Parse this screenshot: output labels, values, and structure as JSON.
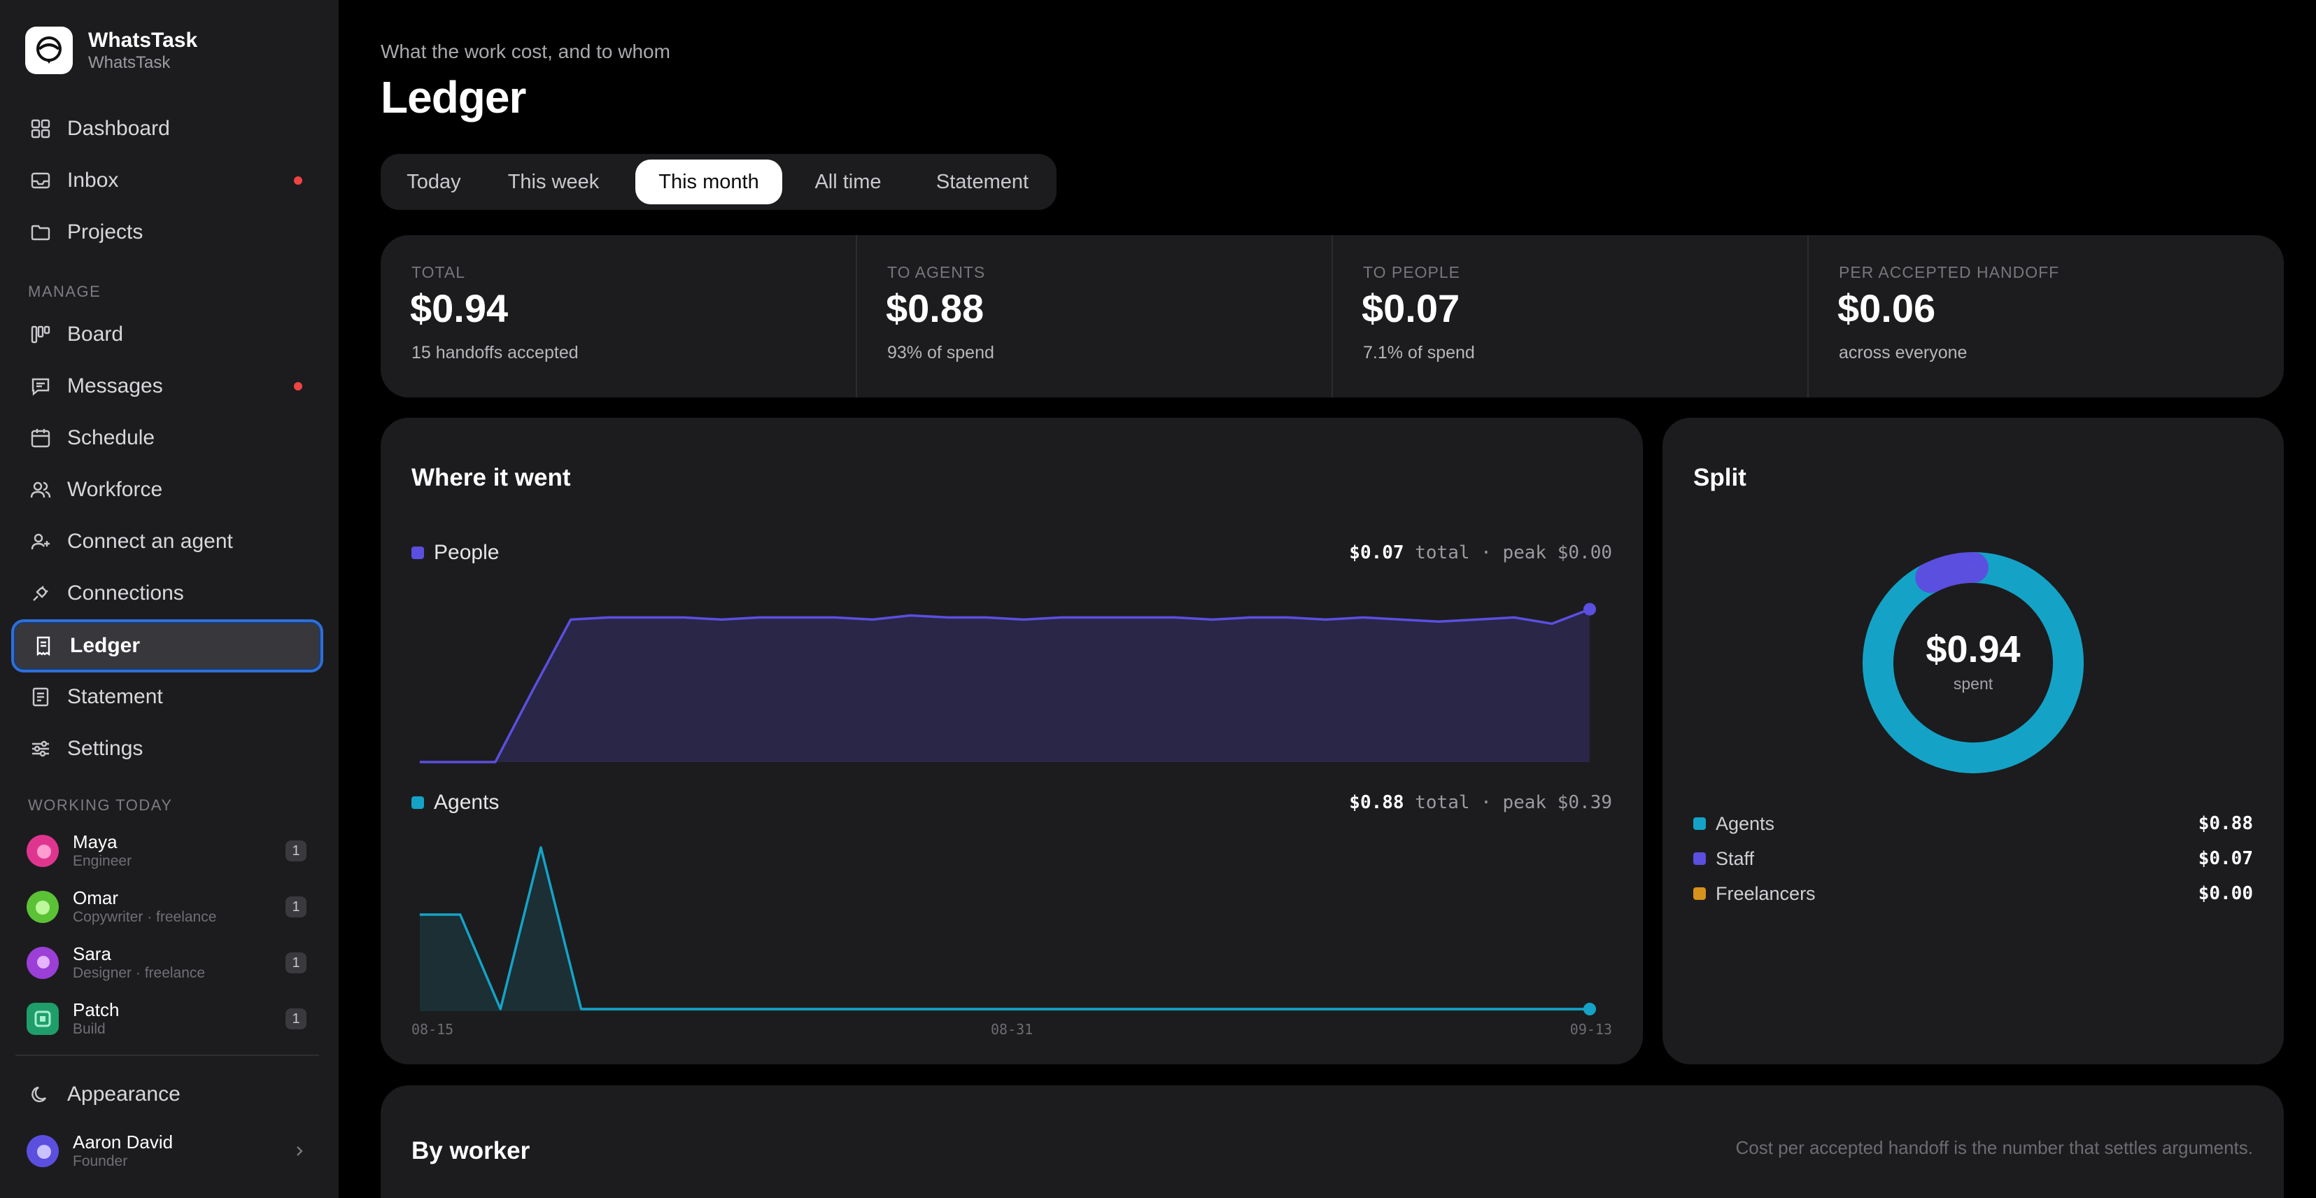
{
  "app": {
    "name": "WhatsTask",
    "workspace": "WhatsTask"
  },
  "nav": {
    "main": [
      {
        "label": "Dashboard",
        "icon": "grid-icon"
      },
      {
        "label": "Inbox",
        "icon": "inbox-icon",
        "unread": true
      },
      {
        "label": "Projects",
        "icon": "folder-icon"
      }
    ],
    "manage_label": "MANAGE",
    "manage": [
      {
        "label": "Board",
        "icon": "board-icon"
      },
      {
        "label": "Messages",
        "icon": "message-icon",
        "unread": true
      },
      {
        "label": "Schedule",
        "icon": "calendar-icon"
      },
      {
        "label": "Workforce",
        "icon": "users-icon"
      },
      {
        "label": "Connect an agent",
        "icon": "user-plus-icon"
      },
      {
        "label": "Connections",
        "icon": "plug-icon"
      },
      {
        "label": "Ledger",
        "icon": "receipt-icon",
        "active": true
      },
      {
        "label": "Statement",
        "icon": "document-icon"
      },
      {
        "label": "Settings",
        "icon": "sliders-icon"
      }
    ]
  },
  "working_today": {
    "label": "WORKING TODAY",
    "workers": [
      {
        "name": "Maya",
        "role": "Engineer",
        "count": "1",
        "color": "#e0358f"
      },
      {
        "name": "Omar",
        "role": "Copywriter · freelance",
        "count": "1",
        "color": "#5bc236"
      },
      {
        "name": "Sara",
        "role": "Designer · freelance",
        "count": "1",
        "color": "#9b3fd6"
      },
      {
        "name": "Patch",
        "role": "Build",
        "count": "1",
        "color": "#1f9e6b"
      }
    ]
  },
  "footer": {
    "appearance": "Appearance",
    "user": {
      "name": "Aaron David",
      "role": "Founder"
    }
  },
  "page": {
    "eyebrow": "What the work cost, and to whom",
    "title": "Ledger"
  },
  "tabs": [
    {
      "label": "Today"
    },
    {
      "label": "This week"
    },
    {
      "label": "This month",
      "active": true
    },
    {
      "label": "All time"
    },
    {
      "label": "Statement"
    }
  ],
  "stats": [
    {
      "label": "TOTAL",
      "value": "$0.94",
      "sub": "15 handoffs accepted"
    },
    {
      "label": "TO AGENTS",
      "value": "$0.88",
      "sub": "93% of spend"
    },
    {
      "label": "TO PEOPLE",
      "value": "$0.07",
      "sub": "7.1% of spend"
    },
    {
      "label": "PER ACCEPTED HANDOFF",
      "value": "$0.06",
      "sub": "across everyone"
    }
  ],
  "where": {
    "title": "Where it went",
    "people": {
      "name": "People",
      "total": "$0.07",
      "suffix": "total · peak $0.00"
    },
    "agents": {
      "name": "Agents",
      "total": "$0.88",
      "suffix": "total · peak $0.39"
    }
  },
  "split": {
    "title": "Split",
    "center_value": "$0.94",
    "center_label": "spent",
    "rows": [
      {
        "name": "Agents",
        "value": "$0.88",
        "color": "#14a3c7"
      },
      {
        "name": "Staff",
        "value": "$0.07",
        "color": "#5b4fe0"
      },
      {
        "name": "Freelancers",
        "value": "$0.00",
        "color": "#d6921c"
      }
    ]
  },
  "by_worker": {
    "title": "By worker",
    "note": "Cost per accepted handoff is the number that settles arguments."
  },
  "colors": {
    "people": "#5b4fe0",
    "agents": "#14a3c7",
    "accent": "#2e6fd8"
  },
  "chart_data": [
    {
      "type": "area",
      "series": [
        {
          "name": "People",
          "values": [
            0,
            0,
            0,
            0.0035,
            0.0069,
            0.007,
            0.007,
            0.007,
            0.0069,
            0.007,
            0.007,
            0.007,
            0.0069,
            0.0071,
            0.007,
            0.007,
            0.0069,
            0.007,
            0.007,
            0.007,
            0.007,
            0.0069,
            0.007,
            0.007,
            0.0069,
            0.007,
            0.0069,
            0.0068,
            0.0069,
            0.007,
            0.0067,
            0.0074
          ]
        }
      ],
      "x_ticks": [
        "08-15",
        "08-31",
        "09-13"
      ]
    },
    {
      "type": "area",
      "series": [
        {
          "name": "Agents",
          "values": [
            0.23,
            0.23,
            0.005,
            0.39,
            0.005,
            0.005,
            0.005,
            0.005,
            0.005,
            0.005,
            0.005,
            0.005,
            0.005,
            0.005,
            0.005,
            0.005,
            0.005,
            0.005,
            0.005,
            0.005,
            0.005,
            0.005,
            0.005,
            0.005,
            0.005,
            0.005,
            0.005,
            0.005,
            0.005,
            0.005
          ]
        }
      ],
      "x_ticks": [
        "08-15",
        "08-31",
        "09-13"
      ]
    },
    {
      "type": "pie",
      "categories": [
        "Agents",
        "Staff",
        "Freelancers"
      ],
      "values": [
        0.88,
        0.07,
        0.0
      ]
    }
  ]
}
